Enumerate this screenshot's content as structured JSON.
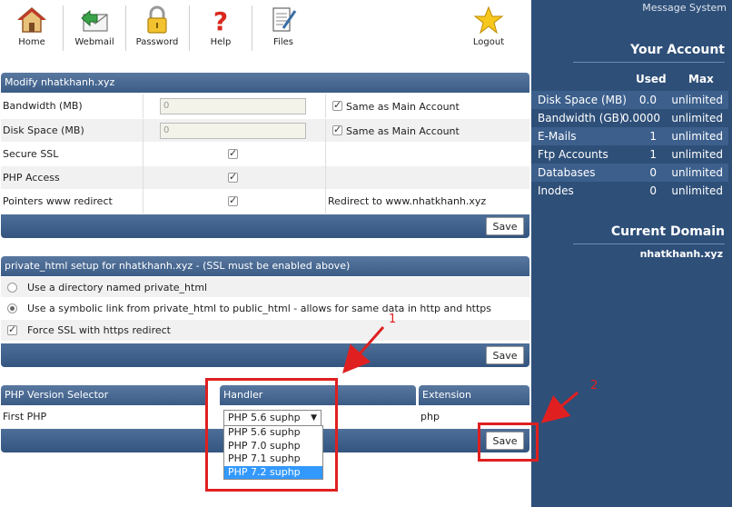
{
  "nav": {
    "home": "Home",
    "webmail": "Webmail",
    "password": "Password",
    "help": "Help",
    "files": "Files",
    "logout": "Logout"
  },
  "sidebar": {
    "message_system": "Message System",
    "your_account": "Your Account",
    "used_header": "Used",
    "max_header": "Max",
    "stats": [
      {
        "label": "Disk Space (MB)",
        "used": "0.0",
        "max": "unlimited"
      },
      {
        "label": "Bandwidth (GB)",
        "used": "0.0000",
        "max": "unlimited"
      },
      {
        "label": "E-Mails",
        "used": "1",
        "max": "unlimited"
      },
      {
        "label": "Ftp Accounts",
        "used": "1",
        "max": "unlimited"
      },
      {
        "label": "Databases",
        "used": "0",
        "max": "unlimited"
      },
      {
        "label": "Inodes",
        "used": "0",
        "max": "unlimited"
      }
    ],
    "current_domain": "Current Domain",
    "domain_name": "nhatkhanh.xyz"
  },
  "modify": {
    "title": "Modify nhatkhanh.xyz",
    "bandwidth_label": "Bandwidth (MB)",
    "bandwidth_value": "0",
    "bandwidth_same": "Same as Main Account",
    "disk_label": "Disk Space (MB)",
    "disk_value": "0",
    "disk_same": "Same as Main Account",
    "ssl_label": "Secure SSL",
    "php_label": "PHP Access",
    "pointers_label": "Pointers www redirect",
    "pointers_note": "Redirect to www.nhatkhanh.xyz",
    "save": "Save"
  },
  "private_html": {
    "title": "private_html setup for nhatkhanh.xyz - (SSL must be enabled above)",
    "opt1": "Use a directory named private_html",
    "opt2": "Use a symbolic link from private_html to public_html - allows for same data in http and https",
    "force_ssl": "Force SSL with https redirect",
    "save": "Save"
  },
  "php": {
    "col1": "PHP Version Selector",
    "col2": "Handler",
    "col3": "Extension",
    "row_label": "First PHP",
    "selected": "PHP 5.6 suphp",
    "extension": "php",
    "options": [
      "PHP 5.6 suphp",
      "PHP 7.0 suphp",
      "PHP 7.1 suphp",
      "PHP 7.2 suphp"
    ],
    "save": "Save"
  },
  "annotations": {
    "one": "1",
    "two": "2"
  },
  "colors": {
    "sidebar": "#2e4f78",
    "header": "#4a6a93",
    "annotation": "#e02020",
    "selected_option": "#3399ff"
  }
}
